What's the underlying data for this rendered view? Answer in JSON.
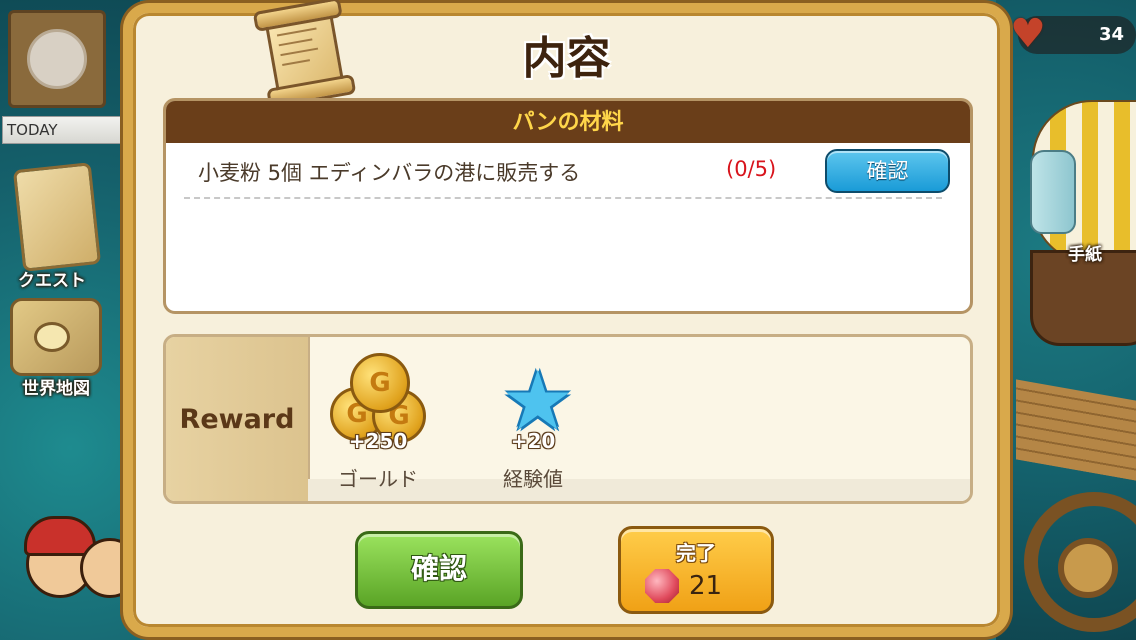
{
  "hud": {
    "today_label": "TODAY",
    "quest_label": "クエスト",
    "world_map_label": "世界地図",
    "letters_label": "手紙",
    "hearts_count": "34"
  },
  "dialog": {
    "title": "内容",
    "quest": {
      "header": "パンの材料",
      "task": "小麦粉 5個 エディンバラの港に販売する",
      "progress": "(0/5)",
      "check_label": "確認"
    },
    "reward": {
      "label": "Reward",
      "items": [
        {
          "amount": "+250",
          "name": "ゴールド",
          "icon": "gold-coin-icon"
        },
        {
          "amount": "+20",
          "name": "経験値",
          "icon": "exp-star-icon"
        }
      ]
    },
    "buttons": {
      "confirm_label": "確認",
      "complete_label": "完了",
      "complete_cost": "21"
    }
  },
  "colors": {
    "dialog_border": "#d9a94b",
    "quest_header_bg": "#6a3e19",
    "quest_header_text": "#ffd64a",
    "progress_red": "#d8141c",
    "blue_button": "#1a9bd7",
    "green_button": "#5aa426",
    "orange_button": "#f0a116"
  }
}
